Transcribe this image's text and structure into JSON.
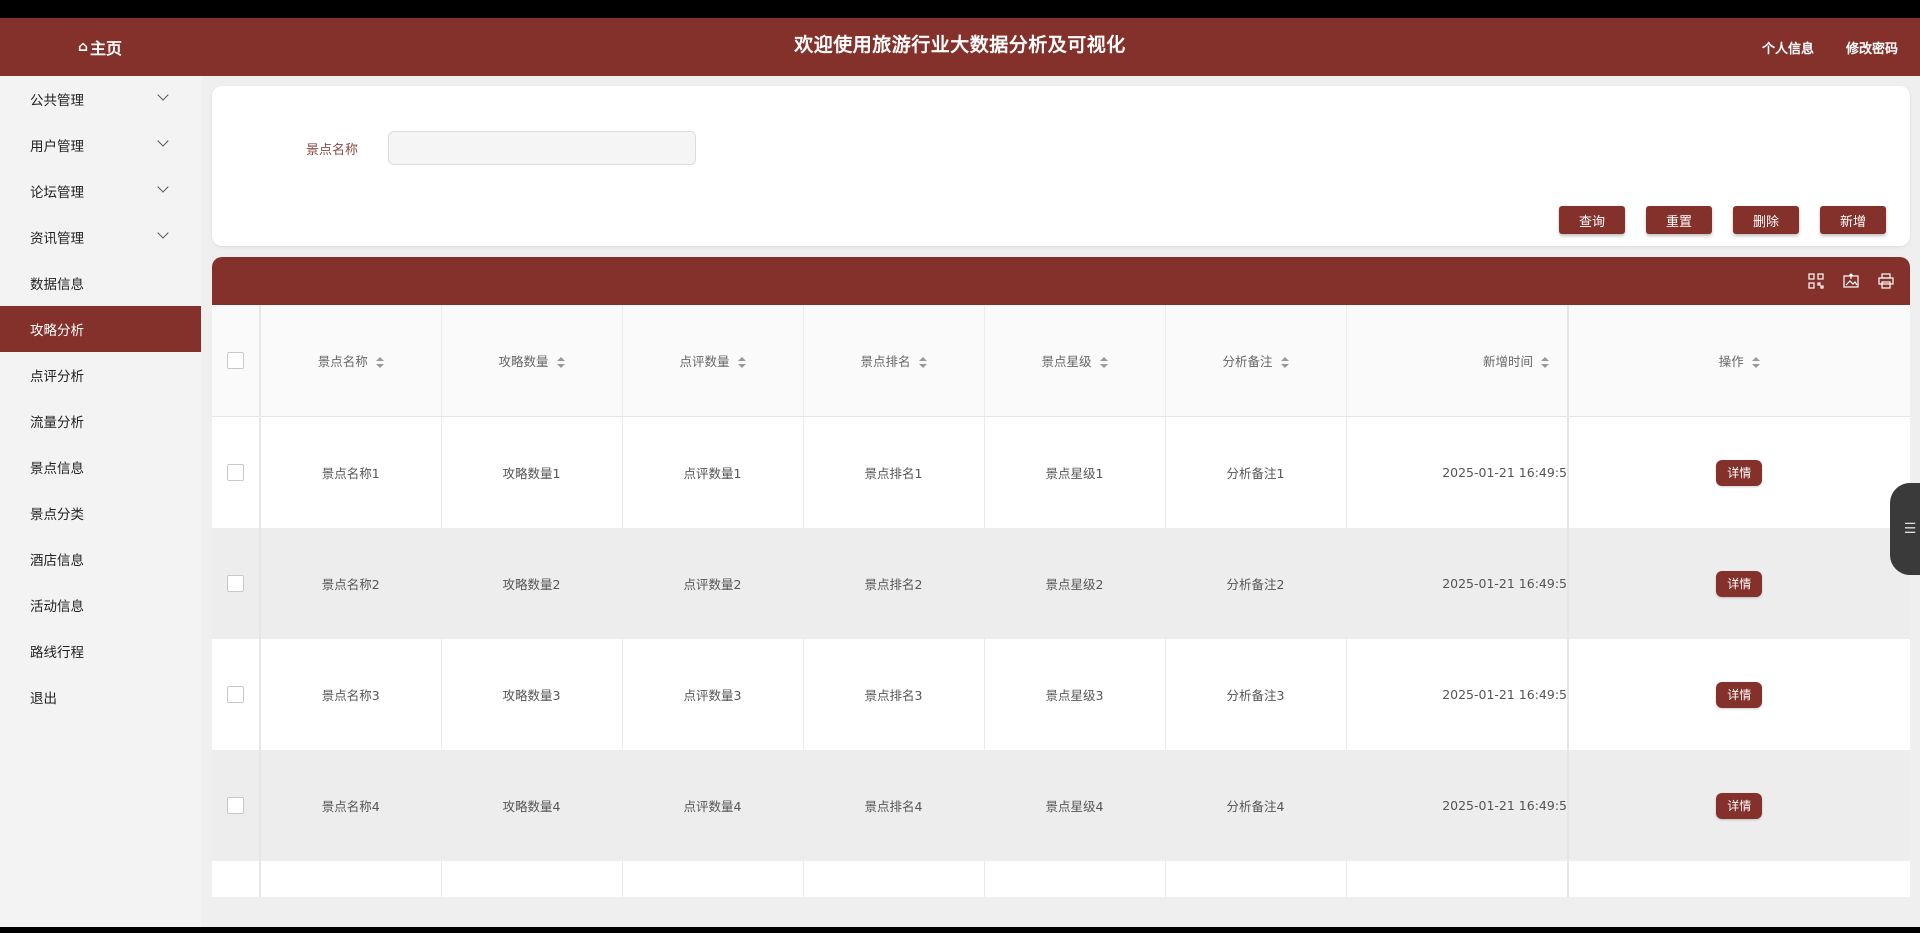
{
  "header": {
    "home_label": "主页",
    "title": "欢迎使用旅游行业大数据分析及可视化",
    "profile_link": "个人信息",
    "change_password_link": "修改密码"
  },
  "sidebar": {
    "items": [
      {
        "label": "公共管理",
        "expandable": true
      },
      {
        "label": "用户管理",
        "expandable": true
      },
      {
        "label": "论坛管理",
        "expandable": true
      },
      {
        "label": "资讯管理",
        "expandable": true
      },
      {
        "label": "数据信息"
      },
      {
        "label": "攻略分析",
        "active": true
      },
      {
        "label": "点评分析"
      },
      {
        "label": "流量分析"
      },
      {
        "label": "景点信息"
      },
      {
        "label": "景点分类"
      },
      {
        "label": "酒店信息"
      },
      {
        "label": "活动信息"
      },
      {
        "label": "路线行程"
      },
      {
        "label": "退出"
      }
    ]
  },
  "search": {
    "label": "景点名称",
    "value": "",
    "buttons": {
      "query": "查询",
      "reset": "重置",
      "delete": "删除",
      "add": "新增"
    }
  },
  "table": {
    "headers": [
      "景点名称",
      "攻略数量",
      "点评数量",
      "景点排名",
      "景点星级",
      "分析备注",
      "新增时间",
      "操作"
    ],
    "rows": [
      [
        "景点名称1",
        "攻略数量1",
        "点评数量1",
        "景点排名1",
        "景点星级1",
        "分析备注1",
        "2025-01-21 16:49:5"
      ],
      [
        "景点名称2",
        "攻略数量2",
        "点评数量2",
        "景点排名2",
        "景点星级2",
        "分析备注2",
        "2025-01-21 16:49:5"
      ],
      [
        "景点名称3",
        "攻略数量3",
        "点评数量3",
        "景点排名3",
        "景点星级3",
        "分析备注3",
        "2025-01-21 16:49:5"
      ],
      [
        "景点名称4",
        "攻略数量4",
        "点评数量4",
        "景点排名4",
        "景点星级4",
        "分析备注4",
        "2025-01-21 16:49:5"
      ]
    ],
    "detail_label": "详情"
  },
  "colors": {
    "accent": "#84312b",
    "sidebar_bg": "#f3f3f3",
    "page_bg": "#efefef"
  }
}
